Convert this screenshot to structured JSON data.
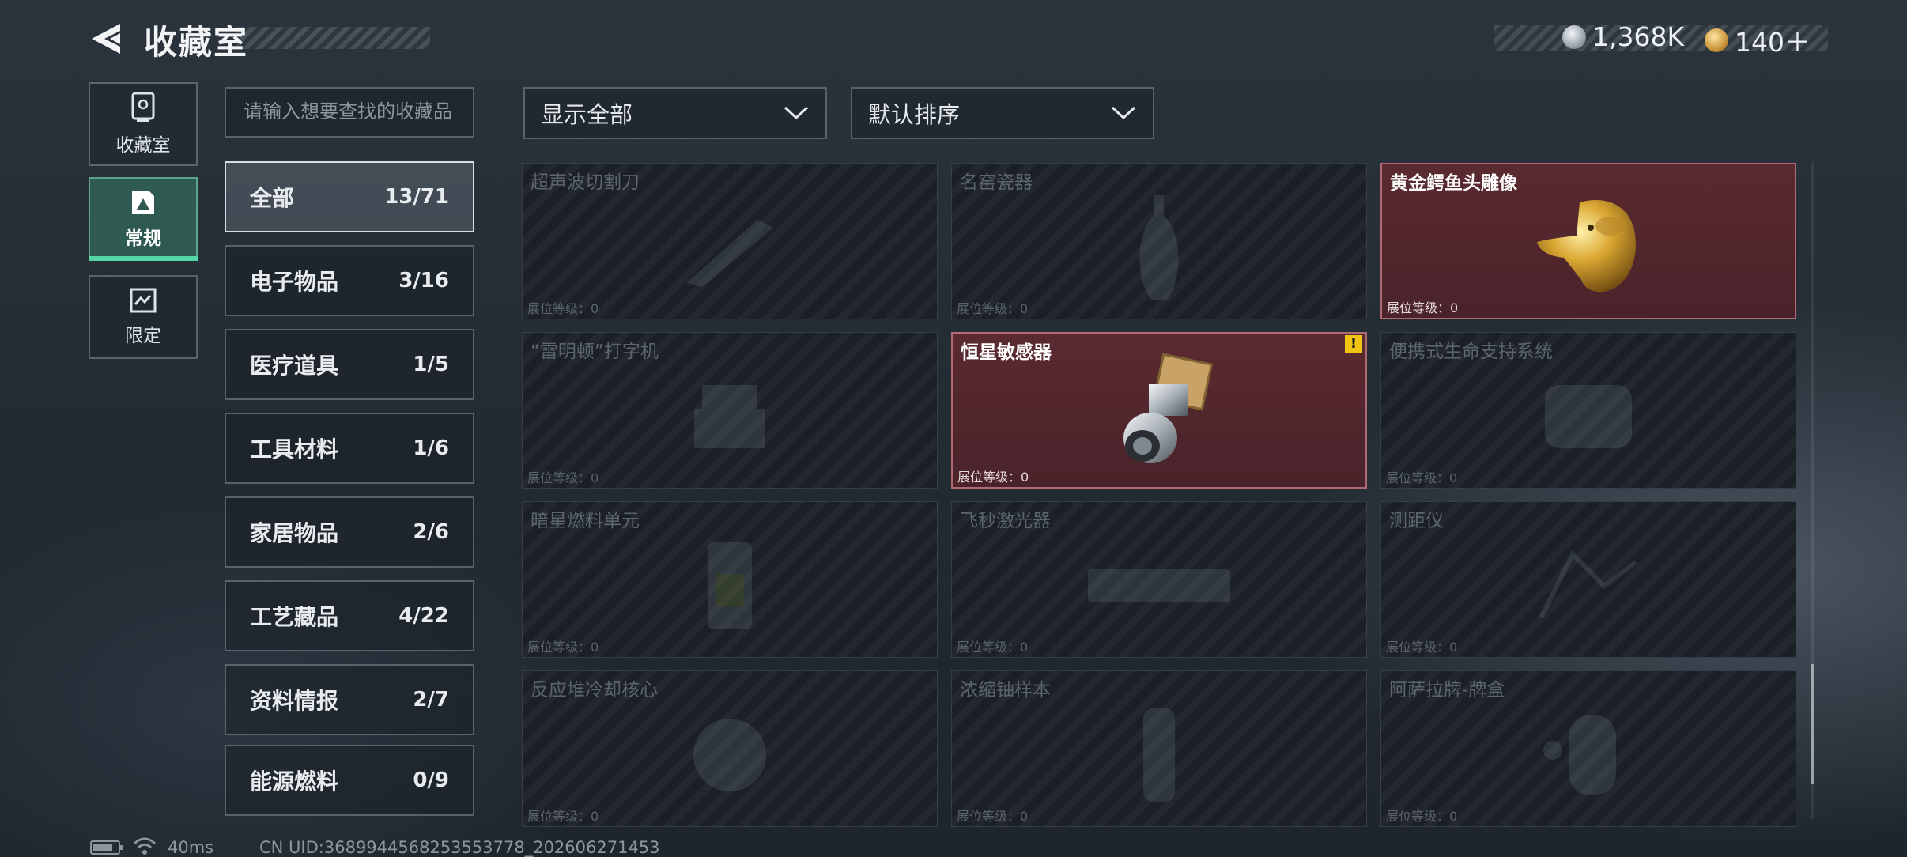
{
  "header": {
    "title": "收藏室",
    "currency": [
      {
        "icon": "silver-coin-icon",
        "value": "1,368K"
      },
      {
        "icon": "gold-coin-icon",
        "value": "140＋"
      }
    ]
  },
  "side_tabs": [
    {
      "label": "收藏室",
      "icon": "trophy-icon"
    },
    {
      "label": "常规",
      "icon": "collection-icon",
      "active": true
    },
    {
      "label": "限定",
      "icon": "limited-card-icon"
    }
  ],
  "search": {
    "placeholder": "请输入想要查找的收藏品"
  },
  "categories": [
    {
      "name": "全部",
      "count": "13/71",
      "active": true
    },
    {
      "name": "电子物品",
      "count": "3/16"
    },
    {
      "name": "医疗道具",
      "count": "1/5"
    },
    {
      "name": "工具材料",
      "count": "1/6"
    },
    {
      "name": "家居物品",
      "count": "2/6"
    },
    {
      "name": "工艺藏品",
      "count": "4/22"
    },
    {
      "name": "资料情报",
      "count": "2/7"
    },
    {
      "name": "能源燃料",
      "count": "0/9"
    }
  ],
  "filters": {
    "display": "显示全部",
    "sort": "默认排序"
  },
  "items": [
    {
      "name": "超声波切割刀",
      "level": "展位等级：0",
      "owned": false
    },
    {
      "name": "名窑瓷器",
      "level": "展位等级：0",
      "owned": false
    },
    {
      "name": "黄金鳄鱼头雕像",
      "level": "展位等级：0",
      "owned": true
    },
    {
      "name": "“雷明顿”打字机",
      "level": "展位等级：0",
      "owned": false
    },
    {
      "name": "恒星敏感器",
      "level": "展位等级：0",
      "owned": true,
      "alert": "!"
    },
    {
      "name": "便携式生命支持系统",
      "level": "展位等级：0",
      "owned": false
    },
    {
      "name": "暗星燃料单元",
      "level": "展位等级：0",
      "owned": false
    },
    {
      "name": "飞秒激光器",
      "level": "展位等级：0",
      "owned": false
    },
    {
      "name": "测距仪",
      "level": "展位等级：0",
      "owned": false
    },
    {
      "name": "反应堆冷却核心",
      "level": "展位等级：0",
      "owned": false
    },
    {
      "name": "浓缩铀样本",
      "level": "展位等级：0",
      "owned": false
    },
    {
      "name": "阿萨拉牌-牌盒",
      "level": "展位等级：0",
      "owned": false
    }
  ],
  "status_bar": {
    "ping": "40ms",
    "uid": "CN UID:3689944568253553778_202606271453",
    "battery_level": 0.8
  }
}
